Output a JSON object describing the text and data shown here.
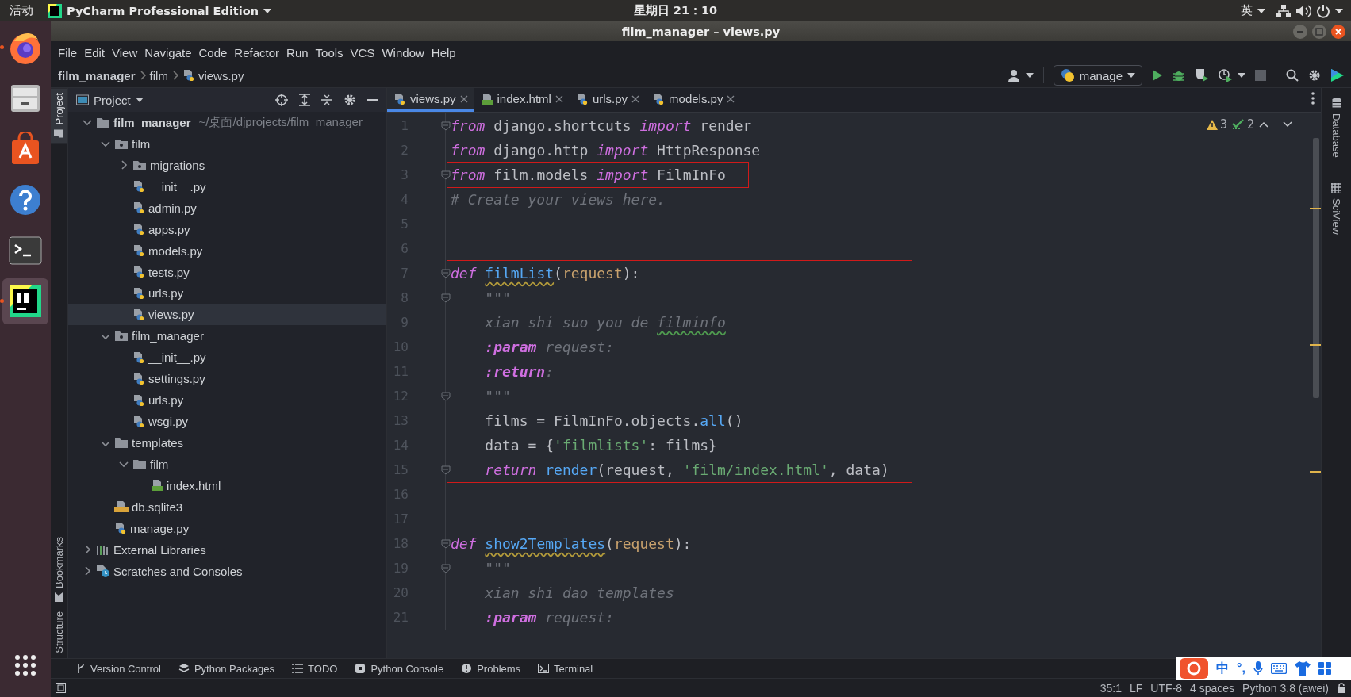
{
  "system_bar": {
    "activities": "活动",
    "app_menu": "PyCharm Professional Edition",
    "clock": "星期日 21：10",
    "input_method": "英"
  },
  "dock": {
    "items": [
      {
        "kind": "firefox",
        "running": true,
        "selected": false
      },
      {
        "kind": "files",
        "running": false,
        "selected": false
      },
      {
        "kind": "software",
        "running": false,
        "selected": false
      },
      {
        "kind": "help",
        "running": false,
        "selected": false
      },
      {
        "kind": "terminal",
        "running": false,
        "selected": false
      },
      {
        "kind": "pycharm",
        "running": true,
        "selected": true
      }
    ]
  },
  "window": {
    "title": "film_manager – views.py"
  },
  "menu": [
    "File",
    "Edit",
    "View",
    "Navigate",
    "Code",
    "Refactor",
    "Run",
    "Tools",
    "VCS",
    "Window",
    "Help"
  ],
  "breadcrumb": [
    {
      "label": "film_manager",
      "kind": "project"
    },
    {
      "label": "film",
      "kind": "folder"
    },
    {
      "label": "views.py",
      "kind": "py"
    }
  ],
  "run_config": "manage",
  "left_strip": {
    "top": [
      {
        "label": "Project",
        "kind": "project",
        "selected": true
      }
    ],
    "bottom": [
      {
        "label": "Bookmarks",
        "kind": "bookmarks",
        "selected": false
      },
      {
        "label": "Structure",
        "kind": "structure",
        "selected": false
      }
    ]
  },
  "project_panel": {
    "title": "Project",
    "tree": [
      {
        "name": "film_manager",
        "path": "~/桌面/djprojects/film_manager",
        "kind": "root",
        "expanded": true,
        "selected": false,
        "children": [
          {
            "name": "film",
            "kind": "package",
            "expanded": true,
            "selected": false,
            "children": [
              {
                "name": "migrations",
                "kind": "package",
                "expanded": false,
                "selected": false
              },
              {
                "name": "__init__.py",
                "kind": "py",
                "selected": false
              },
              {
                "name": "admin.py",
                "kind": "py",
                "selected": false
              },
              {
                "name": "apps.py",
                "kind": "py",
                "selected": false
              },
              {
                "name": "models.py",
                "kind": "py",
                "selected": false
              },
              {
                "name": "tests.py",
                "kind": "py",
                "selected": false
              },
              {
                "name": "urls.py",
                "kind": "py",
                "selected": false
              },
              {
                "name": "views.py",
                "kind": "py",
                "selected": true
              }
            ]
          },
          {
            "name": "film_manager",
            "kind": "package",
            "expanded": true,
            "selected": false,
            "children": [
              {
                "name": "__init__.py",
                "kind": "py",
                "selected": false
              },
              {
                "name": "settings.py",
                "kind": "py",
                "selected": false
              },
              {
                "name": "urls.py",
                "kind": "py",
                "selected": false
              },
              {
                "name": "wsgi.py",
                "kind": "py",
                "selected": false
              }
            ]
          },
          {
            "name": "templates",
            "kind": "folder",
            "expanded": true,
            "selected": false,
            "children": [
              {
                "name": "film",
                "kind": "folder",
                "expanded": true,
                "selected": false,
                "children": [
                  {
                    "name": "index.html",
                    "kind": "html",
                    "selected": false
                  }
                ]
              }
            ]
          },
          {
            "name": "db.sqlite3",
            "kind": "sqlite",
            "selected": false
          },
          {
            "name": "manage.py",
            "kind": "py",
            "selected": false
          }
        ]
      },
      {
        "name": "External Libraries",
        "kind": "libraries",
        "expanded": false,
        "selected": false
      },
      {
        "name": "Scratches and Consoles",
        "kind": "scratches",
        "expanded": false,
        "selected": false
      }
    ]
  },
  "editor_tabs": [
    {
      "label": "views.py",
      "kind": "py",
      "selected": true
    },
    {
      "label": "index.html",
      "kind": "html",
      "selected": false
    },
    {
      "label": "urls.py",
      "kind": "py",
      "selected": false
    },
    {
      "label": "models.py",
      "kind": "py",
      "selected": false
    }
  ],
  "inspections": {
    "warnings": "3",
    "typos": "2"
  },
  "code_blocks": [
    {
      "kind": "plain",
      "lines": [
        {
          "number": "1",
          "fold": true,
          "tokens": [
            {
              "t": "from",
              "kind": "kw"
            },
            {
              "t": " django.shortcuts ",
              "kind": "pl"
            },
            {
              "t": "import",
              "kind": "kw"
            },
            {
              "t": " render",
              "kind": "pl"
            }
          ]
        },
        {
          "number": "2",
          "fold": false,
          "tokens": [
            {
              "t": "from",
              "kind": "kw"
            },
            {
              "t": " django.http ",
              "kind": "pl"
            },
            {
              "t": "import",
              "kind": "kw"
            },
            {
              "t": " HttpResponse",
              "kind": "pl"
            }
          ]
        }
      ]
    },
    {
      "kind": "boxed",
      "lines": [
        {
          "number": "3",
          "fold": true,
          "tokens": [
            {
              "t": "from",
              "kind": "kw"
            },
            {
              "t": " film.models ",
              "kind": "pl"
            },
            {
              "t": "import",
              "kind": "kw"
            },
            {
              "t": " FilmInFo",
              "kind": "pl"
            }
          ]
        }
      ]
    },
    {
      "kind": "plain",
      "lines": [
        {
          "number": "4",
          "fold": false,
          "tokens": [
            {
              "t": "# Create your views here.",
              "kind": "comment"
            }
          ]
        },
        {
          "number": "5",
          "fold": false
        },
        {
          "number": "6",
          "fold": false
        }
      ]
    },
    {
      "kind": "boxed",
      "lines": [
        {
          "number": "7",
          "fold": true,
          "tokens": [
            {
              "t": "def ",
              "kind": "kw"
            },
            {
              "t": "filmList",
              "kind": "fn_squiggle"
            },
            {
              "t": "(",
              "kind": "pl"
            },
            {
              "t": "request",
              "kind": "param"
            },
            {
              "t": "):",
              "kind": "pl"
            }
          ]
        },
        {
          "number": "8",
          "fold": true,
          "tokens": [
            {
              "t": "    \"\"\"",
              "kind": "doc"
            }
          ]
        },
        {
          "number": "9",
          "fold": false,
          "tokens": [
            {
              "t": "    xian shi suo you de ",
              "kind": "doc"
            },
            {
              "t": "filminfo",
              "kind": "doc_squiggle"
            }
          ]
        },
        {
          "number": "10",
          "fold": false,
          "tokens": [
            {
              "t": "    :param",
              "kind": "doctag"
            },
            {
              "t": " request:",
              "kind": "doc"
            }
          ]
        },
        {
          "number": "11",
          "fold": false,
          "tokens": [
            {
              "t": "    :return",
              "kind": "doctag"
            },
            {
              "t": ":",
              "kind": "doc"
            }
          ]
        },
        {
          "number": "12",
          "fold": true,
          "tokens": [
            {
              "t": "    \"\"\"",
              "kind": "doc"
            }
          ]
        },
        {
          "number": "13",
          "fold": false,
          "tokens": [
            {
              "t": "    films = FilmInFo.objects.",
              "kind": "pl"
            },
            {
              "t": "all",
              "kind": "call"
            },
            {
              "t": "()",
              "kind": "pl"
            }
          ]
        },
        {
          "number": "14",
          "fold": false,
          "tokens": [
            {
              "t": "    data = {",
              "kind": "pl"
            },
            {
              "t": "'filmlists'",
              "kind": "str"
            },
            {
              "t": ": films}",
              "kind": "pl"
            }
          ]
        },
        {
          "number": "15",
          "fold": true,
          "tokens": [
            {
              "t": "    return ",
              "kind": "kw"
            },
            {
              "t": "render",
              "kind": "call"
            },
            {
              "t": "(request, ",
              "kind": "pl"
            },
            {
              "t": "'film/index.html'",
              "kind": "str"
            },
            {
              "t": ", data)",
              "kind": "pl"
            }
          ]
        }
      ]
    },
    {
      "kind": "plain",
      "lines": [
        {
          "number": "16",
          "fold": false
        },
        {
          "number": "17",
          "fold": false
        },
        {
          "number": "18",
          "fold": true,
          "tokens": [
            {
              "t": "def ",
              "kind": "kw"
            },
            {
              "t": "show2Templates",
              "kind": "fn_squiggle"
            },
            {
              "t": "(",
              "kind": "pl"
            },
            {
              "t": "request",
              "kind": "param"
            },
            {
              "t": "):",
              "kind": "pl"
            }
          ]
        },
        {
          "number": "19",
          "fold": true,
          "tokens": [
            {
              "t": "    \"\"\"",
              "kind": "doc"
            }
          ]
        },
        {
          "number": "20",
          "fold": false,
          "tokens": [
            {
              "t": "    xian shi dao templates",
              "kind": "doc"
            }
          ]
        },
        {
          "number": "21",
          "fold": false,
          "tokens": [
            {
              "t": "    :param",
              "kind": "doctag"
            },
            {
              "t": " request:",
              "kind": "doc"
            }
          ]
        }
      ]
    }
  ],
  "right_strip": [
    {
      "label": "Database",
      "kind": "database"
    },
    {
      "label": "SciView",
      "kind": "sciview"
    }
  ],
  "tool_windows": [
    {
      "label": "Version Control",
      "kind": "vcs"
    },
    {
      "label": "Python Packages",
      "kind": "packages"
    },
    {
      "label": "TODO",
      "kind": "todo"
    },
    {
      "label": "Python Console",
      "kind": "console"
    },
    {
      "label": "Problems",
      "kind": "problems"
    },
    {
      "label": "Terminal",
      "kind": "terminal"
    }
  ],
  "status_bar": {
    "position": "35:1",
    "line_separator": "LF",
    "encoding": "UTF-8",
    "indent": "4 spaces",
    "interpreter": "Python 3.8 (awei)"
  },
  "ime_toolbar": {
    "mode": "中",
    "punctuation": "°,"
  }
}
